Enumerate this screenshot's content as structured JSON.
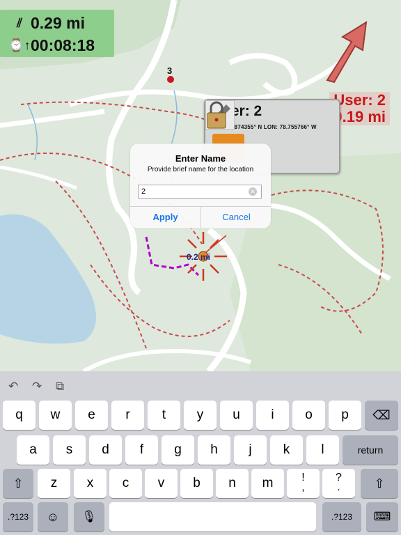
{
  "stats": {
    "distance": "0.29 mi",
    "elapsed": "00:08:18",
    "distance_icon": "route-icon",
    "timer_icon": "watch-up-icon"
  },
  "user_overlay": {
    "user": "User: 2",
    "distance": "0.19 mi"
  },
  "markers": {
    "waypoint_number": "3",
    "track_label": "0.2 mi"
  },
  "user_card": {
    "title": "User: 2",
    "coords": "LAT: 35.874355° N LON: 78.755766° W"
  },
  "alert": {
    "title": "Enter Name",
    "message": "Provide brief name for the location",
    "input_value": "2",
    "apply_label": "Apply",
    "cancel_label": "Cancel"
  },
  "keyboard": {
    "row1": [
      "q",
      "w",
      "e",
      "r",
      "t",
      "y",
      "u",
      "i",
      "o",
      "p"
    ],
    "row2": [
      "a",
      "s",
      "d",
      "f",
      "g",
      "h",
      "j",
      "k",
      "l"
    ],
    "row3": [
      "z",
      "x",
      "c",
      "v",
      "b",
      "n",
      "m"
    ],
    "return_label": "return",
    "num_label": ".?123",
    "punct1_top": "!",
    "punct1_bottom": ",",
    "punct2_top": "?",
    "punct2_bottom": "."
  },
  "colors": {
    "accent": "#1a73e8",
    "alert_red": "#c8171d",
    "stats_bg": "#78c878"
  }
}
